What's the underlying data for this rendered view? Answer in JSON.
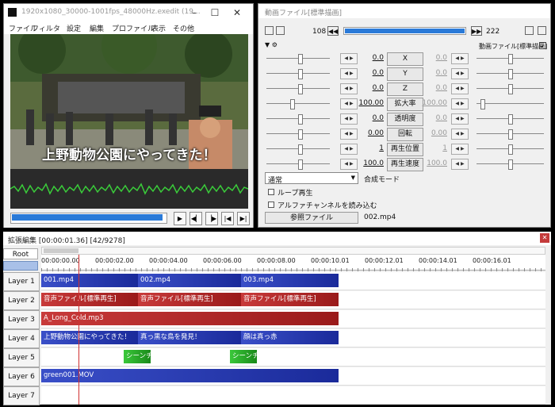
{
  "main": {
    "title": "1920x1080_30000-1001fps_48000Hz.exedit (19...",
    "menu": [
      "ファイル",
      "フィルタ",
      "設定",
      "編集",
      "プロファイル",
      "表示",
      "その他"
    ],
    "subtitle": "上野動物公園にやってきた！",
    "seek_fraction": 0.98
  },
  "props": {
    "title": "動画ファイル[標準描画]",
    "frame_start": "108",
    "frame_end": "222",
    "profile_label": "動画ファイル[標準描画]",
    "rows": [
      {
        "left": "0.0",
        "label": "X",
        "right": "0.0"
      },
      {
        "left": "0.0",
        "label": "Y",
        "right": "0.0"
      },
      {
        "left": "0.0",
        "label": "Z",
        "right": "0.0"
      },
      {
        "left": "100.00",
        "label": "拡大率",
        "right": "100.00"
      },
      {
        "left": "0.0",
        "label": "透明度",
        "right": "0.0"
      },
      {
        "left": "0.00",
        "label": "回転",
        "right": "0.00"
      },
      {
        "left": "1",
        "label": "再生位置",
        "right": "1"
      },
      {
        "left": "100.0",
        "label": "再生速度",
        "right": "100.0"
      }
    ],
    "blend_value": "通常",
    "blend_label": "合成モード",
    "loop_label": "ループ再生",
    "alpha_label": "アルファチャンネルを読み込む",
    "ref_button": "参照ファイル",
    "ref_file": "002.mp4"
  },
  "timeline": {
    "title": "拡張編集 [00:00:01.36] [42/9278]",
    "root_label": "Root",
    "ticks": [
      "00:00:00.00",
      "00:00:02.00",
      "00:00:04.00",
      "00:00:06.00",
      "00:00:08.00",
      "00:00:10.01",
      "00:00:12.01",
      "00:00:14.01",
      "00:00:16.01"
    ],
    "layers": [
      "Layer 1",
      "Layer 2",
      "Layer 3",
      "Layer 4",
      "Layer 5",
      "Layer 6",
      "Layer 7"
    ],
    "clips": {
      "l1": [
        "001.mp4",
        "002.mp4",
        "003.mp4"
      ],
      "l2": [
        "音声ファイル[標準再生]",
        "音声ファイル[標準再生]",
        "音声ファイル[標準再生]"
      ],
      "l3": [
        "A_Long_Cold.mp3"
      ],
      "l4": [
        "上野動物公園にやってきた！",
        "真っ黒な鳥を発見！",
        "顔は真っ赤"
      ],
      "l5": [
        "シーンチ",
        "シーンチ"
      ],
      "l6": [
        "green001.MOV"
      ]
    }
  }
}
